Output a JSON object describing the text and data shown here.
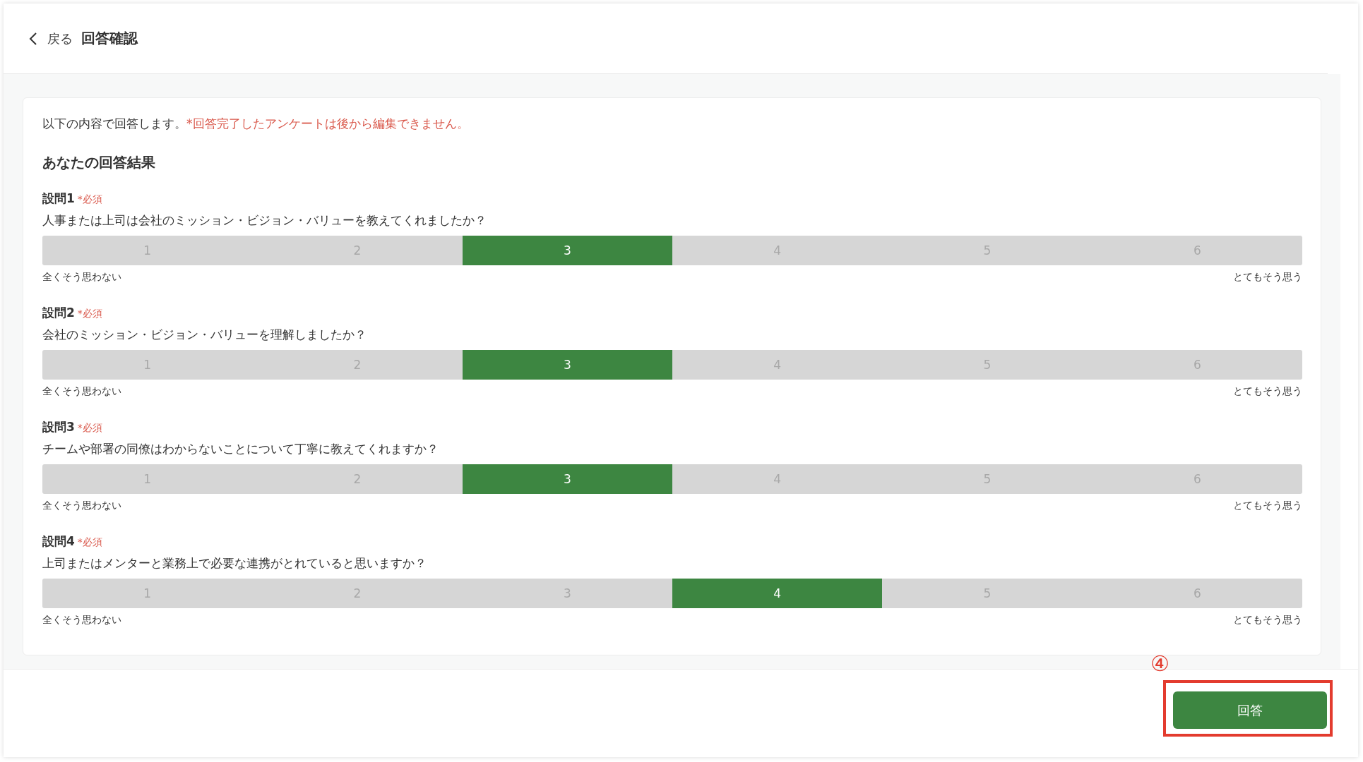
{
  "header": {
    "back_label": "戻る",
    "title": "回答確認"
  },
  "intro": {
    "text": "以下の内容で回答します。",
    "warning": "*回答完了したアンケートは後から編集できません。"
  },
  "results_heading": "あなたの回答結果",
  "questions": [
    {
      "label": "設問1",
      "required_mark": "*必須",
      "text": "人事または上司は会社のミッション・ビジョン・バリューを教えてくれましたか？",
      "options": [
        {
          "label": "1",
          "selected": false
        },
        {
          "label": "2",
          "selected": false
        },
        {
          "label": "3",
          "selected": true
        },
        {
          "label": "4",
          "selected": false
        },
        {
          "label": "5",
          "selected": false
        },
        {
          "label": "6",
          "selected": false
        }
      ],
      "min_label": "全くそう思わない",
      "max_label": "とてもそう思う"
    },
    {
      "label": "設問2",
      "required_mark": "*必須",
      "text": "会社のミッション・ビジョン・バリューを理解しましたか？",
      "options": [
        {
          "label": "1",
          "selected": false
        },
        {
          "label": "2",
          "selected": false
        },
        {
          "label": "3",
          "selected": true
        },
        {
          "label": "4",
          "selected": false
        },
        {
          "label": "5",
          "selected": false
        },
        {
          "label": "6",
          "selected": false
        }
      ],
      "min_label": "全くそう思わない",
      "max_label": "とてもそう思う"
    },
    {
      "label": "設問3",
      "required_mark": "*必須",
      "text": "チームや部署の同僚はわからないことについて丁寧に教えてくれますか？",
      "options": [
        {
          "label": "1",
          "selected": false
        },
        {
          "label": "2",
          "selected": false
        },
        {
          "label": "3",
          "selected": true
        },
        {
          "label": "4",
          "selected": false
        },
        {
          "label": "5",
          "selected": false
        },
        {
          "label": "6",
          "selected": false
        }
      ],
      "min_label": "全くそう思わない",
      "max_label": "とてもそう思う"
    },
    {
      "label": "設問4",
      "required_mark": "*必須",
      "text": "上司またはメンターと業務上で必要な連携がとれていると思いますか？",
      "options": [
        {
          "label": "1",
          "selected": false
        },
        {
          "label": "2",
          "selected": false
        },
        {
          "label": "3",
          "selected": false
        },
        {
          "label": "4",
          "selected": true
        },
        {
          "label": "5",
          "selected": false
        },
        {
          "label": "6",
          "selected": false
        }
      ],
      "min_label": "全くそう思わない",
      "max_label": "とてもそう思う"
    }
  ],
  "submit_button": "回答",
  "annotation": {
    "label": "④"
  }
}
